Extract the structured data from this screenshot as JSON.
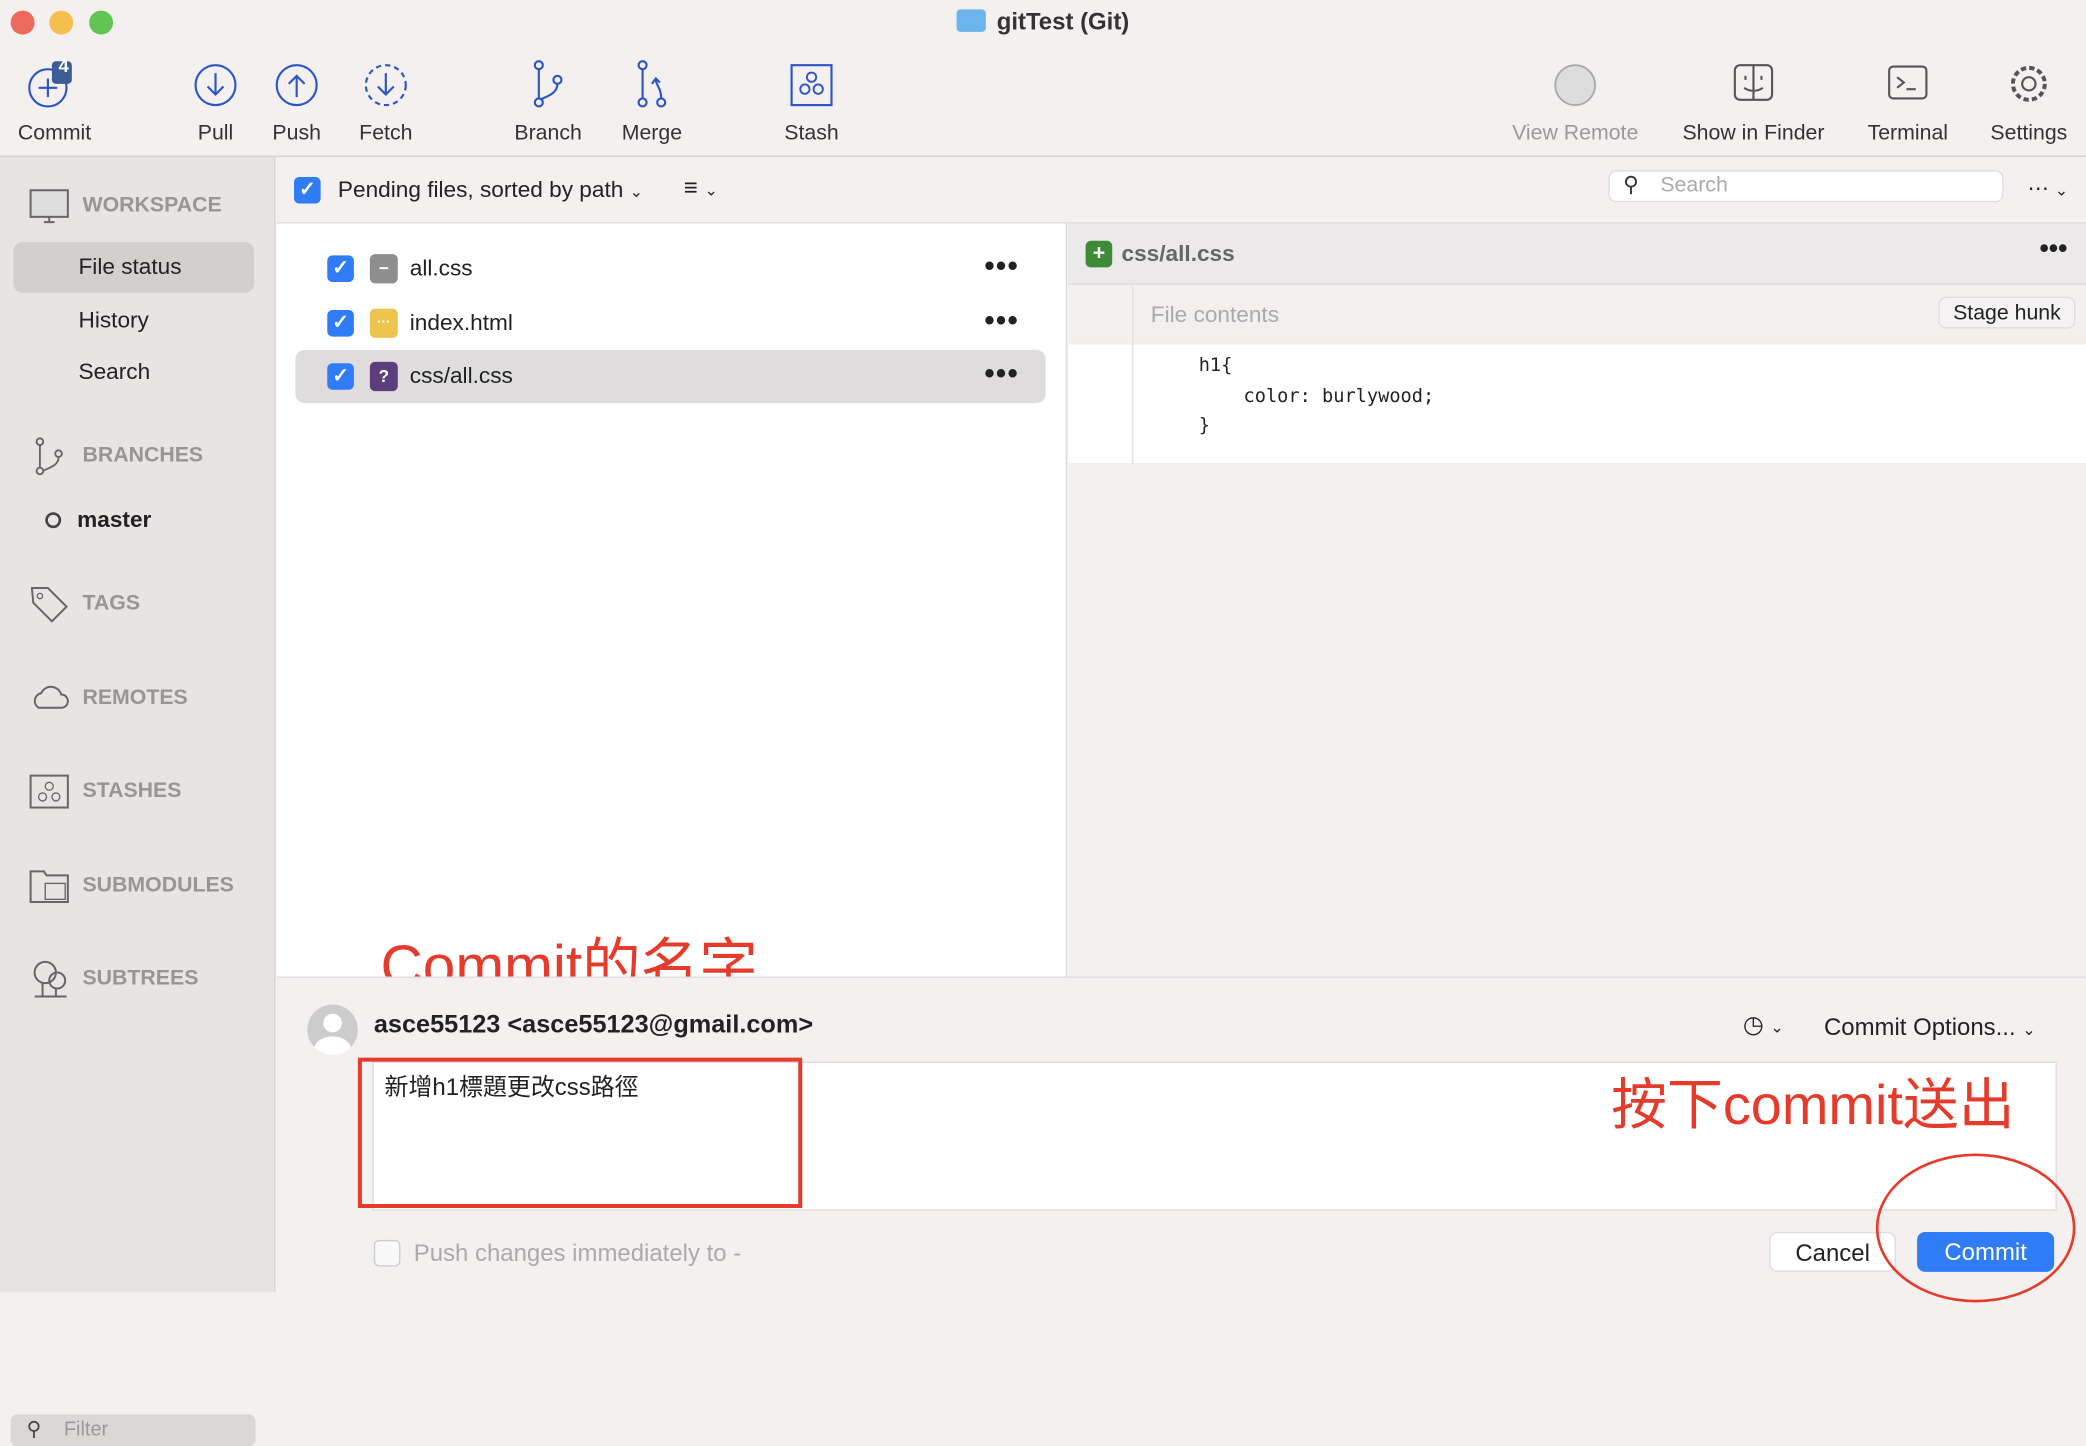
{
  "window": {
    "title": "gitTest (Git)"
  },
  "toolbar": {
    "commit": {
      "label": "Commit",
      "badge": "4"
    },
    "pull": "Pull",
    "push": "Push",
    "fetch": "Fetch",
    "branch": "Branch",
    "merge": "Merge",
    "stash": "Stash",
    "view_remote": "View Remote",
    "show_in_finder": "Show in Finder",
    "terminal": "Terminal",
    "settings": "Settings"
  },
  "sidebar": {
    "workspace": "WORKSPACE",
    "items": [
      {
        "label": "File status",
        "selected": true
      },
      {
        "label": "History"
      },
      {
        "label": "Search"
      }
    ],
    "branches": "BRANCHES",
    "current_branch": "master",
    "tags": "TAGS",
    "remotes": "REMOTES",
    "stashes": "STASHES",
    "submodules": "SUBMODULES",
    "subtrees": "SUBTREES",
    "filter_placeholder": "Filter"
  },
  "files_header": {
    "sort_label": "Pending files, sorted by path",
    "search_placeholder": "Search"
  },
  "files": [
    {
      "name": "all.css",
      "status": "removed",
      "color": "#8e8e8e",
      "glyph": "−"
    },
    {
      "name": "index.html",
      "status": "modified",
      "color": "#ecc54f",
      "glyph": "···"
    },
    {
      "name": "css/all.css",
      "status": "untracked",
      "color": "#5a3f7c",
      "glyph": "?",
      "selected": true
    }
  ],
  "diff": {
    "file": "css/all.css",
    "hunk_label": "File contents",
    "stage_hunk": "Stage hunk",
    "lines": [
      "h1{",
      "    color: burlywood;",
      "}"
    ]
  },
  "commit": {
    "author": "asce55123 <asce55123@gmail.com>",
    "message": "新增h1標題更改css路徑",
    "options": "Commit Options...",
    "push_immediately": "Push changes immediately to -",
    "cancel": "Cancel",
    "commit": "Commit"
  },
  "annotations": {
    "name_note": "Commit的名字",
    "press_note": "按下commit送出"
  },
  "colors": {
    "accent": "#2f7cf6",
    "annotation": "#e53b2c",
    "added": "#3d8b37"
  }
}
